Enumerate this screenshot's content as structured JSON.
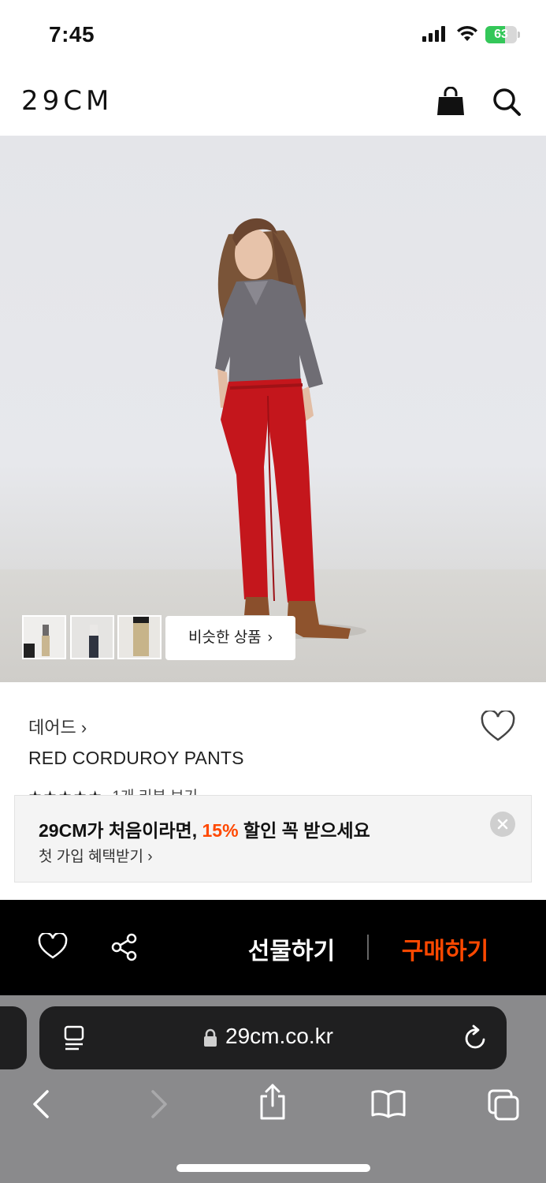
{
  "status": {
    "time": "7:45",
    "battery": "63",
    "battery_level": 0.63
  },
  "header": {
    "logo": "29CM"
  },
  "product": {
    "similar_label": "비슷한 상품",
    "brand": "데어드",
    "name": "RED CORDUROY PANTS",
    "rating_stars": "★★★★★",
    "review_link": "1개 리뷰 보기"
  },
  "promo": {
    "title_prefix": "29CM가 처음이라면, ",
    "title_highlight": "15%",
    "title_suffix": " 할인 꼭 받으세요",
    "subtitle": "첫 가입 혜택받기",
    "highlight_color": "#ff4800"
  },
  "actions": {
    "gift_label": "선물하기",
    "buy_label": "구매하기"
  },
  "browser": {
    "url": "29cm.co.kr"
  },
  "icons": [
    "bag-icon",
    "search-icon",
    "heart-icon",
    "share-icon",
    "reader-icon",
    "lock-icon",
    "reload-icon",
    "back-icon",
    "forward-icon",
    "share-sheet-icon",
    "bookmarks-icon",
    "tabs-icon"
  ]
}
